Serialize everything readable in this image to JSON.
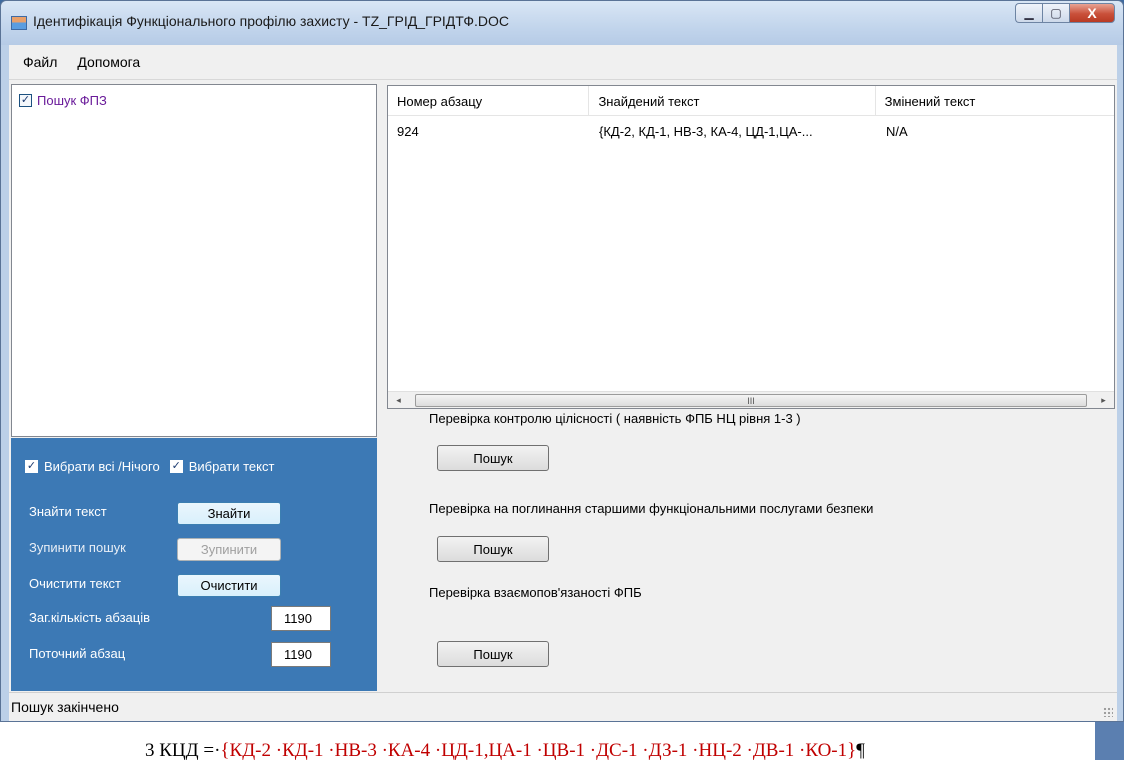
{
  "window": {
    "title": "Ідентифікація Функціонального профілю захисту - TZ_ГРІД_ГРІДТФ.DOC",
    "min_glyph": "▁",
    "max_glyph": "▢",
    "close_glyph": "X"
  },
  "menu": {
    "file": "Файл",
    "help": "Допомога"
  },
  "tree": {
    "items": [
      {
        "label": "Пошук ФПЗ",
        "checked": true
      }
    ]
  },
  "controls": {
    "select_all_label": "Вибрати всі /Нічого",
    "select_text_label": "Вибрати  текст",
    "find_text_label": "Знайти текст",
    "find_button": "Знайти",
    "stop_label": "Зупинити пошук",
    "stop_button": "Зупинити",
    "clear_label": "Очистити текст",
    "clear_button": "Очистити",
    "total_label": "Заг.кількість абзаців",
    "total_value": "1190",
    "current_label": "Поточний абзац",
    "current_value": "1190"
  },
  "list": {
    "columns": [
      "Номер абзацу",
      "Знайдений текст",
      "Змінений текст"
    ],
    "rows": [
      [
        "924",
        "{КД-2, КД-1, НВ-3, КА-4, ЦД-1,ЦА-...",
        "N/A"
      ]
    ],
    "scroll_left": "◂",
    "scroll_right": "▸",
    "thumb_grip": "III"
  },
  "checks": {
    "integrity_label": "Перевірка контролю цілісності ( наявність ФПБ НЦ рівня 1-3 )",
    "absorption_label": "Перевірка на поглинання старшими функціональними послугами безпеки",
    "interdependence_label": "Перевірка взаємопов'язаності ФПБ",
    "search_button": "Пошук"
  },
  "status": {
    "text": "Пошук закінчено"
  },
  "background_doc": {
    "prefix": "3 КЦД =·",
    "colored": "{КД-2 ·КД-1 ·НВ-3 ·КА-4 ·ЦД-1,ЦА-1 ·ЦВ-1 ·ДС-1 ·ДЗ-1 ·НЦ-2 ·ДВ-1 ·КО-1}",
    "suffix": "¶"
  },
  "colors": {
    "control_panel": "#3c79b5",
    "tree_label": "#6a1b9a"
  }
}
